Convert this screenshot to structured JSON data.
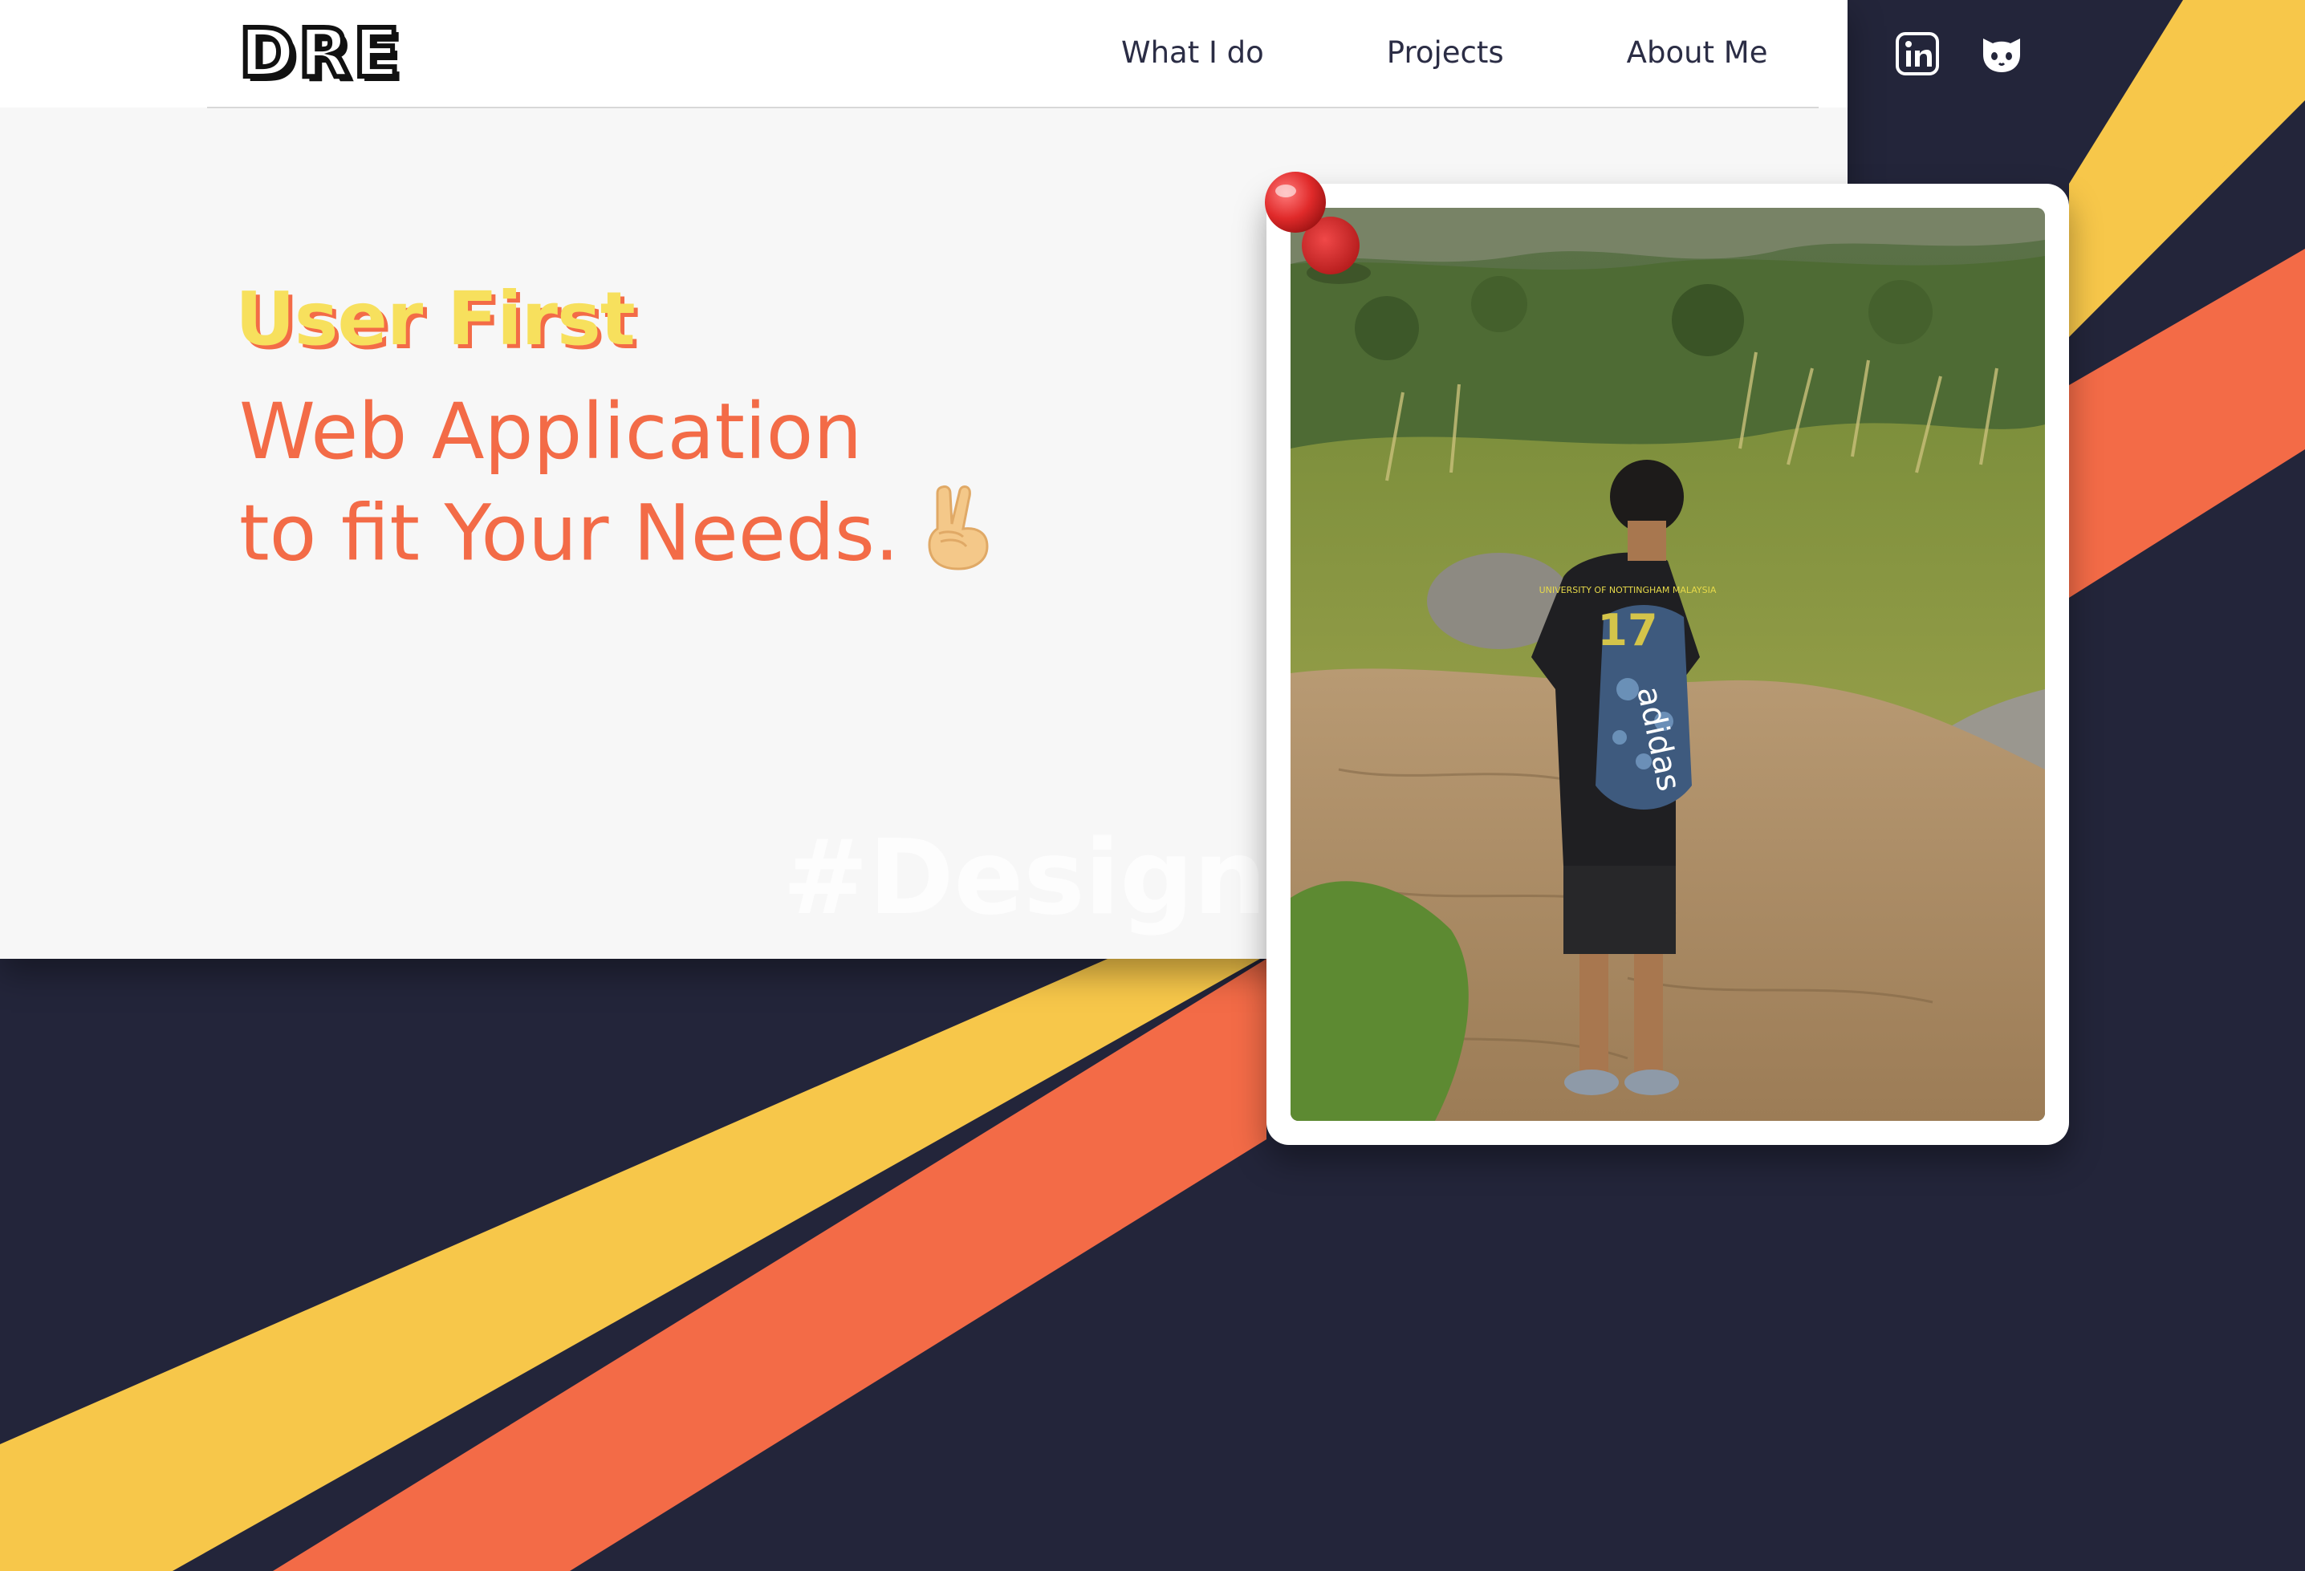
{
  "brand": {
    "logo_text": "DRE"
  },
  "nav": {
    "items": [
      {
        "label": "What I do"
      },
      {
        "label": "Projects"
      },
      {
        "label": "About Me"
      }
    ]
  },
  "social": [
    {
      "icon": "linkedin-icon"
    },
    {
      "icon": "github-icon"
    }
  ],
  "hero": {
    "tagline": "User First",
    "headline_line1": "Web Application",
    "headline_line2": "to fit Your Needs.",
    "emoji_icon": "victory-hand-icon",
    "watermark": "#Design"
  },
  "photo": {
    "shirt_text": "UNIVERSITY OF NOTTINGHAM MALAYSIA",
    "shirt_number": "17",
    "bag_text": "adidas"
  },
  "colors": {
    "navy": "#23253a",
    "yellow": "#f7c74a",
    "orange": "#f36b47",
    "tagline": "#f7e05d",
    "light": "#f7f7f7"
  }
}
